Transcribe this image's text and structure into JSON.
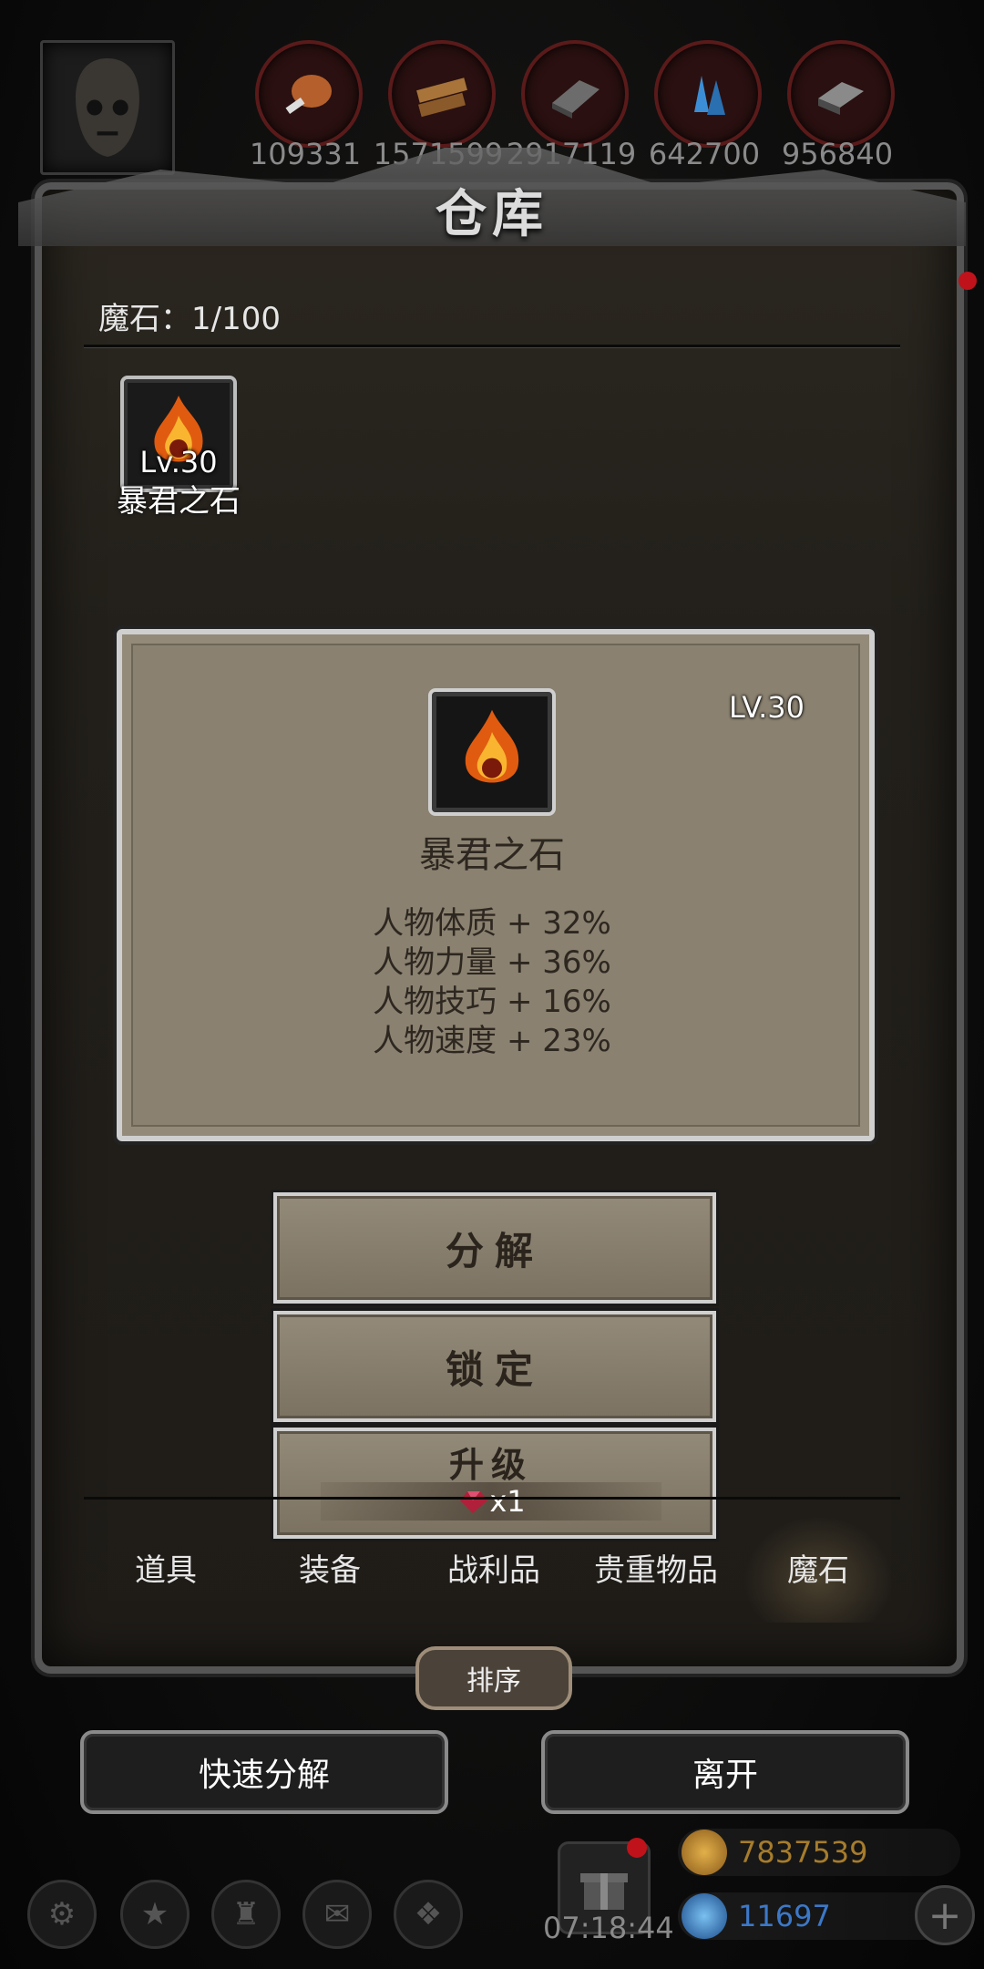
{
  "resources": [
    {
      "icon": "meat-icon",
      "value": "109331"
    },
    {
      "icon": "wood-icon",
      "value": "1571599"
    },
    {
      "icon": "iron-icon",
      "value": "2917119"
    },
    {
      "icon": "crystal-icon",
      "value": "642700"
    },
    {
      "icon": "steel-icon",
      "value": "956840"
    }
  ],
  "title": "仓库",
  "counter": "魔石：1/100",
  "slot": {
    "level": "Lv.30",
    "name": "暴君之石",
    "icon": "fire-stone-icon"
  },
  "detail": {
    "level": "LV.30",
    "name": "暴君之石",
    "stats": [
      "人物体质 + 32%",
      "人物力量 + 36%",
      "人物技巧 + 16%",
      "人物速度 + 23%"
    ]
  },
  "actions": {
    "decompose": "分解",
    "lock": "锁定",
    "upgrade": "升级",
    "upgrade_cost": "x1"
  },
  "tabs": [
    "道具",
    "装备",
    "战利品",
    "贵重物品",
    "魔石"
  ],
  "active_tab": "魔石",
  "sort_label": "排序",
  "quick_decompose": "快速分解",
  "leave": "离开",
  "hud": {
    "clock": "07:18:44",
    "gold": "7837539",
    "gems": "11697"
  },
  "colors": {
    "card_bg": "#8a8170",
    "alert_red": "#c0121a",
    "gold_text": "#a67c2c",
    "gem_text": "#3c78c8"
  }
}
